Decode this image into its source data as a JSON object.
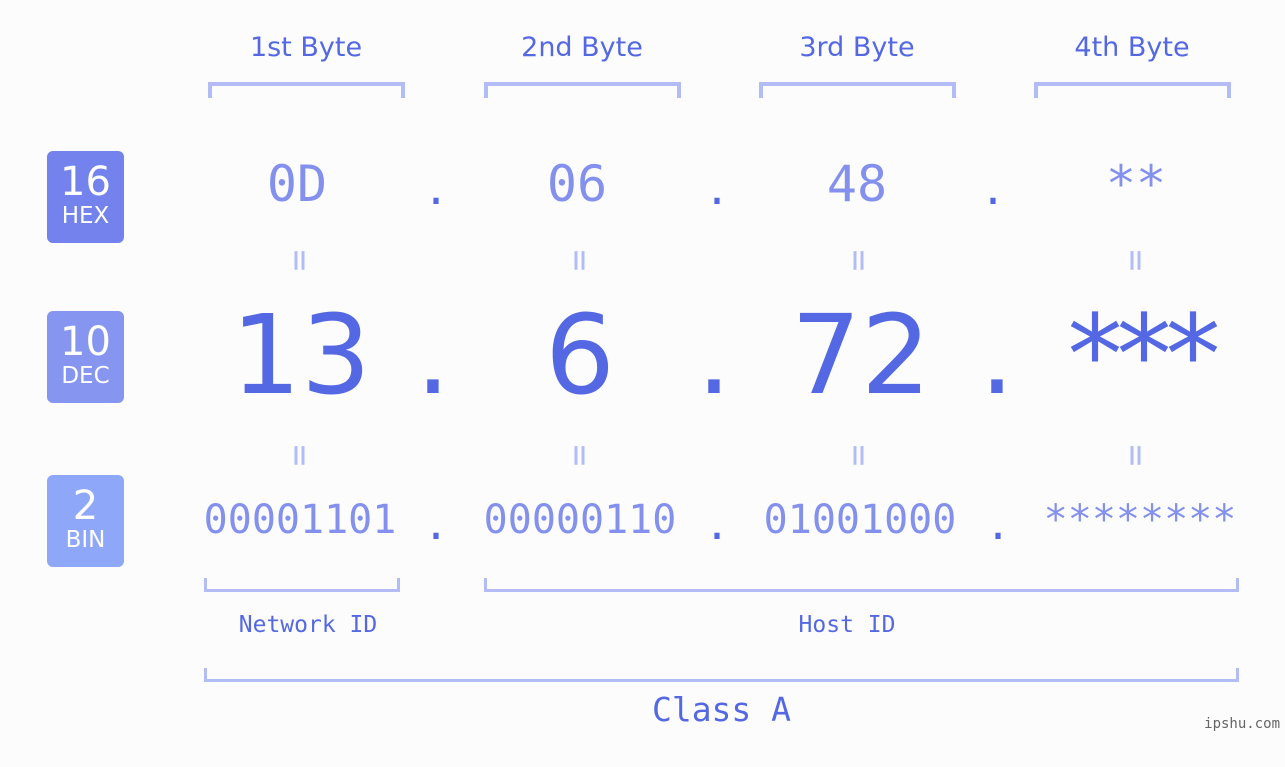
{
  "bytes": {
    "labels": [
      "1st Byte",
      "2nd Byte",
      "3rd Byte",
      "4th Byte"
    ]
  },
  "badges": {
    "hex": {
      "num": "16",
      "label": "HEX",
      "color": "#7382ec"
    },
    "dec": {
      "num": "10",
      "label": "DEC",
      "color": "#8595f0"
    },
    "bin": {
      "num": "2",
      "label": "BIN",
      "color": "#8fa7f8"
    }
  },
  "separator": ".",
  "equals": "=",
  "hex_values": [
    "0D",
    "06",
    "48",
    "**"
  ],
  "dec_values": [
    "13",
    "6",
    "72",
    "***"
  ],
  "bin_values": [
    "00001101",
    "00000110",
    "01001000",
    "********"
  ],
  "segments": {
    "network": "Network ID",
    "host": "Host ID",
    "class": "Class A"
  },
  "watermark": "ipshu.com",
  "colors": {
    "accent": "#5468e4",
    "light_accent": "#8390ed",
    "bracket": "#b3bcf5",
    "background": "#fbfcfb"
  }
}
